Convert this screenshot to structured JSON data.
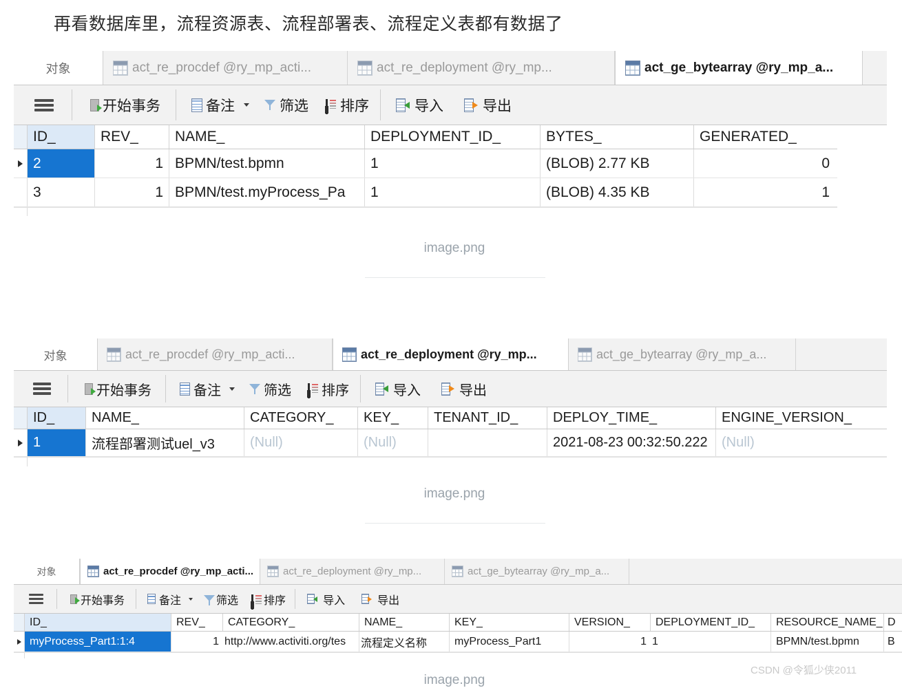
{
  "article": {
    "heading": "再看数据库里，流程资源表、流程部署表、流程定义表都有数据了",
    "caption_1": "image.png",
    "caption_2": "image.png",
    "caption_3": "image.png",
    "watermark": "CSDN @令狐少侠2011"
  },
  "toolbar": {
    "menu_icon": "hamburger-icon",
    "begin_transaction": "开始事务",
    "remark": "备注",
    "remark_caret": "chevron-down-icon",
    "filter": "筛选",
    "sort": "排序",
    "import": "导入",
    "export": "导出"
  },
  "panels": [
    {
      "id": "panel-bytearray",
      "object_tab": "对象",
      "tabs": [
        {
          "label": "act_re_procdef @ry_mp_acti...",
          "active": false
        },
        {
          "label": "act_re_deployment @ry_mp...",
          "active": false
        },
        {
          "label": "act_ge_bytearray @ry_mp_a...",
          "active": true
        }
      ],
      "columns": [
        "ID_",
        "REV_",
        "NAME_",
        "DEPLOYMENT_ID_",
        "BYTES_",
        "GENERATED_"
      ],
      "rows": [
        {
          "current": true,
          "cells": [
            "2",
            "1",
            "BPMN/test.bpmn",
            "1",
            "(BLOB) 2.77 KB",
            "0"
          ]
        },
        {
          "current": false,
          "cells": [
            "3",
            "1",
            "BPMN/test.myProcess_Pa",
            "1",
            "(BLOB) 4.35 KB",
            "1"
          ]
        }
      ]
    },
    {
      "id": "panel-deployment",
      "object_tab": "对象",
      "tabs": [
        {
          "label": "act_re_procdef @ry_mp_acti...",
          "active": false
        },
        {
          "label": "act_re_deployment @ry_mp...",
          "active": true
        },
        {
          "label": "act_ge_bytearray @ry_mp_a...",
          "active": false
        }
      ],
      "columns": [
        "ID_",
        "NAME_",
        "CATEGORY_",
        "KEY_",
        "TENANT_ID_",
        "DEPLOY_TIME_",
        "ENGINE_VERSION_"
      ],
      "rows": [
        {
          "current": true,
          "cells": [
            "1",
            "流程部署测试uel_v3",
            "(Null)",
            "(Null)",
            "",
            "2021-08-23 00:32:50.222",
            "(Null)"
          ]
        }
      ]
    },
    {
      "id": "panel-procdef",
      "object_tab": "对象",
      "tabs": [
        {
          "label": "act_re_procdef @ry_mp_acti...",
          "active": true
        },
        {
          "label": "act_re_deployment @ry_mp...",
          "active": false
        },
        {
          "label": "act_ge_bytearray @ry_mp_a...",
          "active": false
        }
      ],
      "columns": [
        "ID_",
        "REV_",
        "CATEGORY_",
        "NAME_",
        "KEY_",
        "VERSION_",
        "DEPLOYMENT_ID_",
        "RESOURCE_NAME_",
        "D"
      ],
      "rows": [
        {
          "current": true,
          "cells": [
            "myProcess_Part1:1:4",
            "1",
            "http://www.activiti.org/tes",
            "流程定义名称",
            "myProcess_Part1",
            "1",
            "1",
            "BPMN/test.bpmn",
            "B"
          ]
        }
      ]
    }
  ],
  "colors": {
    "selection": "#1675d1",
    "tab_bar": "#f2f2f2",
    "id_header": "#dce9f7",
    "null_text": "#b9c6d2"
  }
}
